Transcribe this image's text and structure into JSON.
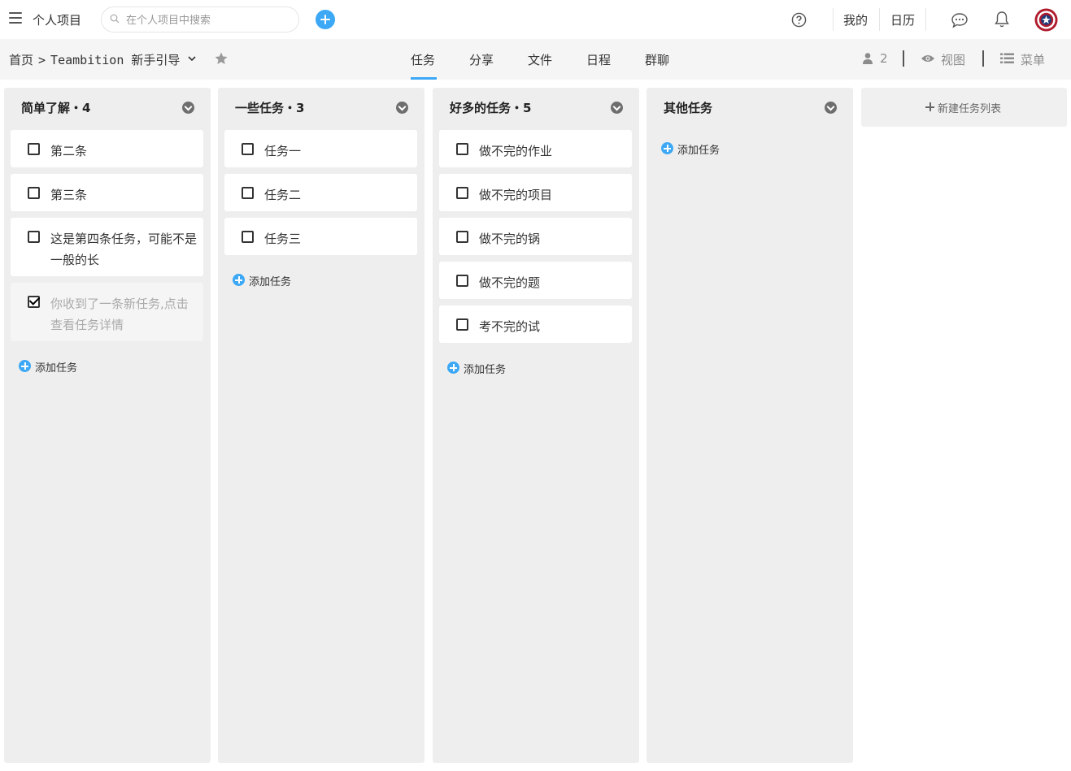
{
  "header": {
    "app_title": "个人项目",
    "search_placeholder": "在个人项目中搜索",
    "my_label": "我的",
    "calendar_label": "日历"
  },
  "subheader": {
    "breadcrumb_home": "首页",
    "breadcrumb_sep": ">",
    "project_name": "Teambition 新手引导",
    "tabs": [
      {
        "label": "任务",
        "active": true
      },
      {
        "label": "分享",
        "active": false
      },
      {
        "label": "文件",
        "active": false
      },
      {
        "label": "日程",
        "active": false
      },
      {
        "label": "群聊",
        "active": false
      }
    ],
    "members_count": "2",
    "view_label": "视图",
    "menu_label": "菜单"
  },
  "columns": [
    {
      "title": "简单了解・4",
      "tasks": [
        {
          "text": "第二条",
          "done": false
        },
        {
          "text": "第三条",
          "done": false
        },
        {
          "text": "这是第四条任务，可能不是一般的长",
          "done": false
        },
        {
          "text": "你收到了一条新任务,点击查看任务详情",
          "done": true
        }
      ],
      "add_label": "添加任务"
    },
    {
      "title": "一些任务・3",
      "tasks": [
        {
          "text": "任务一",
          "done": false
        },
        {
          "text": "任务二",
          "done": false
        },
        {
          "text": "任务三",
          "done": false
        }
      ],
      "add_label": "添加任务"
    },
    {
      "title": "好多的任务・5",
      "tasks": [
        {
          "text": "做不完的作业",
          "done": false
        },
        {
          "text": "做不完的项目",
          "done": false
        },
        {
          "text": "做不完的锅",
          "done": false
        },
        {
          "text": "做不完的题",
          "done": false
        },
        {
          "text": "考不完的试",
          "done": false
        }
      ],
      "add_label": "添加任务"
    },
    {
      "title": "其他任务",
      "tasks": [],
      "add_label": "添加任务"
    }
  ],
  "new_list_label": "新建任务列表",
  "colors": {
    "accent": "#3da8f5",
    "column_bg": "#eeeeee",
    "subbar_bg": "#f5f5f5"
  }
}
